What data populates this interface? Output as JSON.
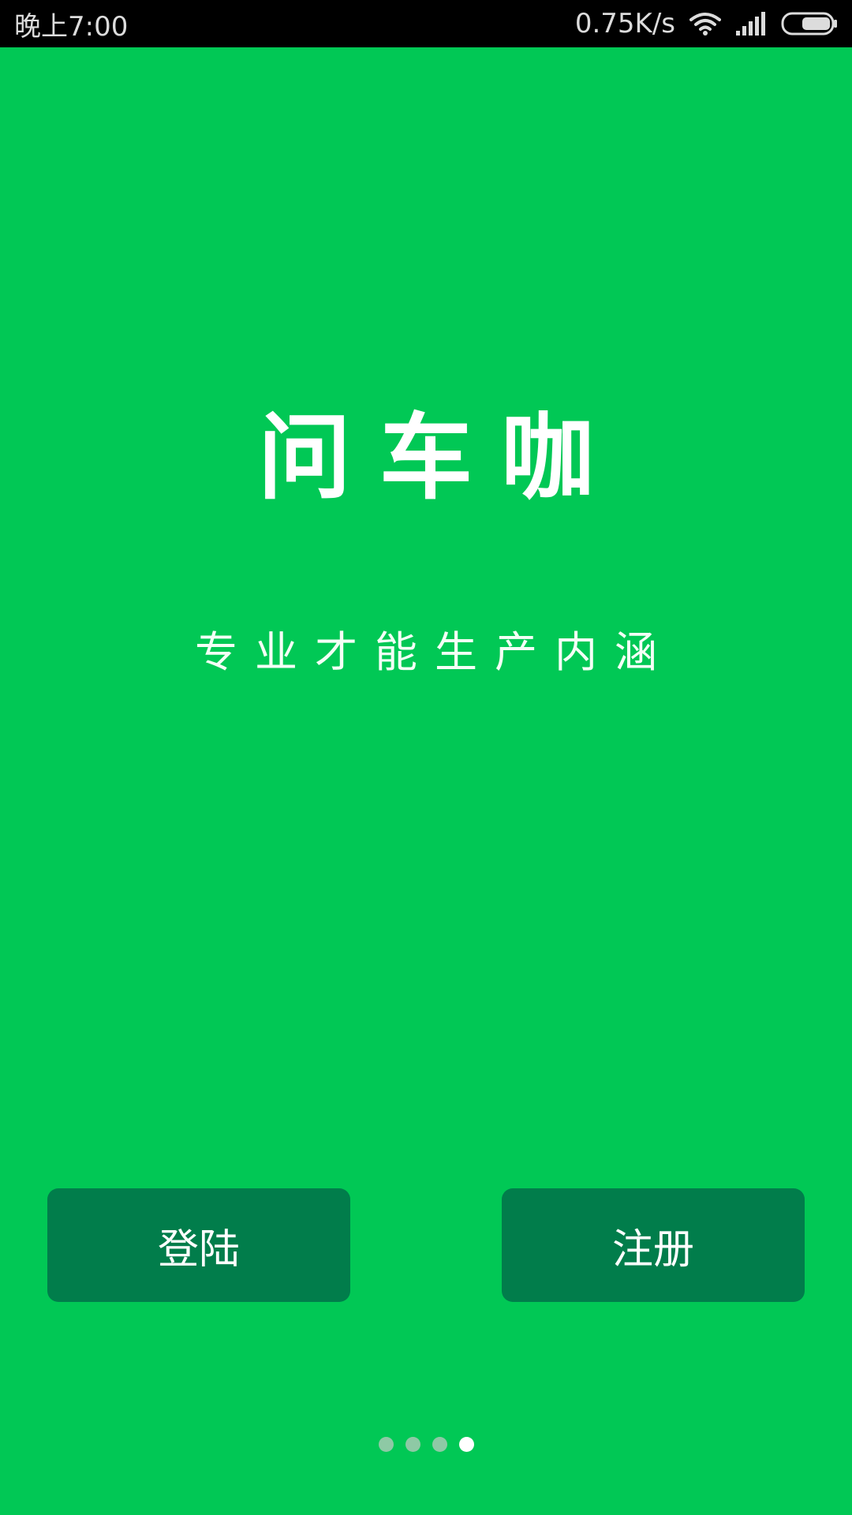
{
  "status_bar": {
    "time": "晚上7:00",
    "speed": "0.75K/s",
    "icons": [
      "wifi-icon",
      "cellular-signal-icon",
      "battery-icon"
    ]
  },
  "splash": {
    "title": "问车咖",
    "slogan": "专业才能生产内涵"
  },
  "buttons": {
    "login_label": "登陆",
    "register_label": "注册"
  },
  "pager": {
    "total": 4,
    "active_index": 3
  },
  "colors": {
    "background": "#01c855",
    "button": "#017d4b",
    "status_bar": "#000000",
    "dot_inactive": "#a7c9b4",
    "dot_active": "#ffffff"
  }
}
